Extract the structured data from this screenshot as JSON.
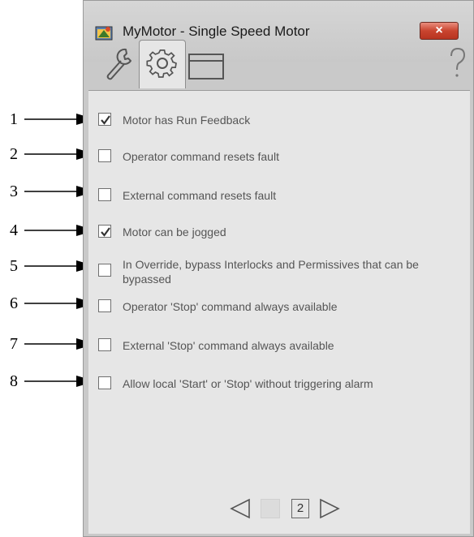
{
  "window": {
    "title": "MyMotor - Single Speed Motor",
    "close_label": "×",
    "help_label": "?",
    "tabs": [
      {
        "name": "wrench-tab",
        "icon": "wrench-icon",
        "selected": false
      },
      {
        "name": "gear-tab",
        "icon": "gear-icon",
        "selected": true
      },
      {
        "name": "window-tab",
        "icon": "window-icon",
        "selected": false
      }
    ]
  },
  "options": [
    {
      "label": "Motor has Run Feedback",
      "checked": true
    },
    {
      "label": "Operator command resets fault",
      "checked": false
    },
    {
      "label": "External command resets fault",
      "checked": false
    },
    {
      "label": "Motor can be jogged",
      "checked": true
    },
    {
      "label": "In Override, bypass Interlocks and Permissives that can be bypassed",
      "checked": false
    },
    {
      "label": "Operator 'Stop' command always available",
      "checked": false
    },
    {
      "label": "External 'Stop' command always available",
      "checked": false
    },
    {
      "label": "Allow local 'Start' or 'Stop' without triggering alarm",
      "checked": false
    }
  ],
  "callouts": [
    "1",
    "2",
    "3",
    "4",
    "5",
    "6",
    "7",
    "8"
  ],
  "pager": {
    "current_page": "2"
  },
  "colors": {
    "close_button": "#c9442f",
    "tab_selected_bg": "#e6e6e6",
    "window_bg": "#c9c9c9"
  }
}
